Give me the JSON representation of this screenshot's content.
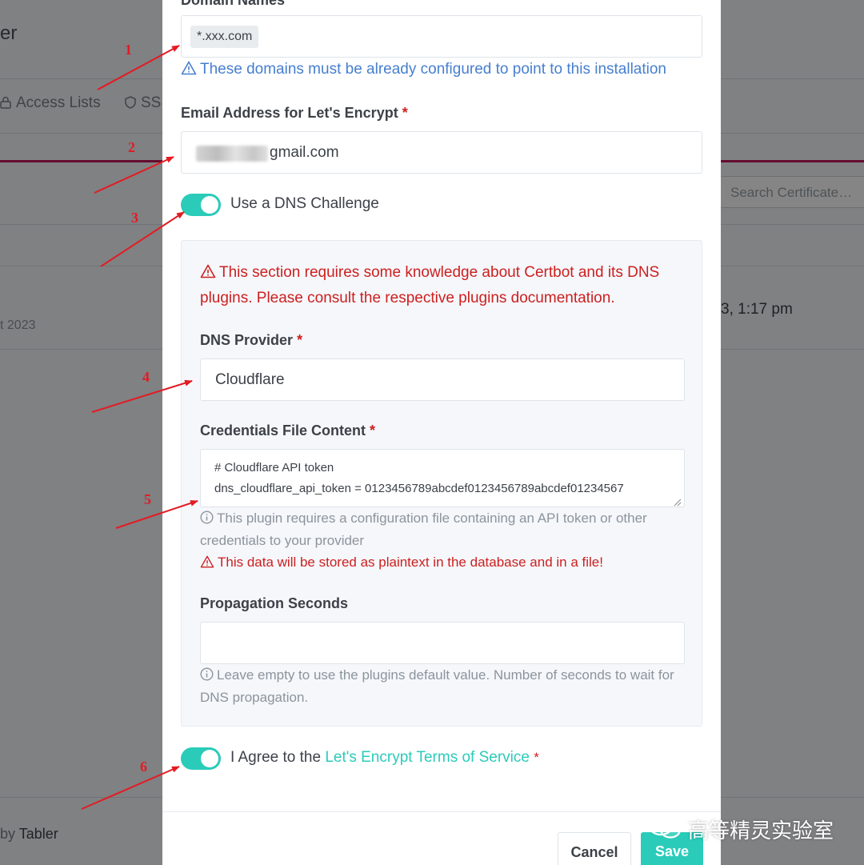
{
  "background": {
    "title_fragment": "er",
    "nav": {
      "access_lists": "Access Lists",
      "ssl_fragment": "SS"
    },
    "search_placeholder": "Search Certificate…",
    "row_date_right": "3, 1:17 pm",
    "row_date_left": "t 2023",
    "footer_by": "by",
    "footer_brand": "Tabler"
  },
  "form": {
    "domain_names": {
      "label": "Domain Names",
      "chip": "*.xxx.com",
      "hint": "These domains must be already configured to point to this installation"
    },
    "email": {
      "label": "Email Address for Let's Encrypt",
      "required_mark": "*",
      "value": "gmail.com"
    },
    "dns_challenge": {
      "label": "Use a DNS Challenge",
      "enabled": true
    },
    "dns_section": {
      "warning": "This section requires some knowledge about Certbot and its DNS plugins. Please consult the respective plugins documentation.",
      "provider": {
        "label": "DNS Provider",
        "required_mark": "*",
        "value": "Cloudflare"
      },
      "credentials": {
        "label": "Credentials File Content",
        "required_mark": "*",
        "lines": [
          "# Cloudflare API token",
          "dns_cloudflare_api_token = 0123456789abcdef0123456789abcdef01234567"
        ],
        "help": "This plugin requires a configuration file containing an API token or other credentials to your provider",
        "warning": "This data will be stored as plaintext in the database and in a file!"
      },
      "propagation": {
        "label": "Propagation Seconds",
        "value": "",
        "help": "Leave empty to use the plugins default value. Number of seconds to wait for DNS propagation."
      }
    },
    "agree": {
      "prefix": "I Agree to the ",
      "link": "Let's Encrypt Terms of Service",
      "required_mark": "*",
      "enabled": true
    },
    "buttons": {
      "cancel": "Cancel",
      "save": "Save"
    }
  },
  "annotations": {
    "numbers": [
      "1",
      "2",
      "3",
      "4",
      "5",
      "6"
    ],
    "color": "#e31b23"
  },
  "watermark": {
    "text": "高等精灵实验室",
    "icon": "wechat-icon"
  },
  "colors": {
    "accent": "#2bcbba",
    "danger": "#cd201f",
    "info": "#467fcf"
  }
}
